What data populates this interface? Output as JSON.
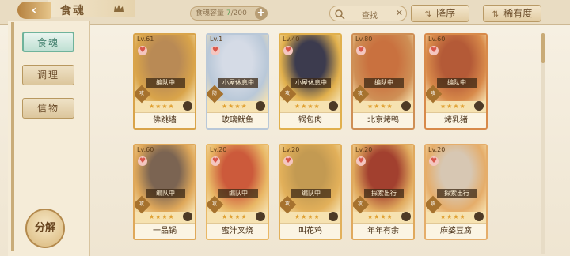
{
  "header": {
    "title": "食魂",
    "capacity_label": "食魂容量",
    "capacity_current": "7",
    "capacity_max": "/200",
    "search_label": "查找",
    "sort_desc_label": "降序",
    "sort_rarity_label": "稀有度"
  },
  "sidebar": {
    "tabs": [
      {
        "label": "食魂",
        "active": true
      },
      {
        "label": "调理",
        "active": false
      },
      {
        "label": "信物",
        "active": false
      }
    ],
    "decompose_label": "分解"
  },
  "cards": [
    {
      "level": "Lv.61",
      "status": "编队中",
      "element": "攻",
      "name": "佛跳墙",
      "bg": "#d9a44a",
      "art": "#b98a55"
    },
    {
      "level": "Lv.1",
      "status": "小屋休息中",
      "element": "防",
      "name": "玻璃鱿鱼",
      "bg": "#b9c8d8",
      "art": "#d5dbe6"
    },
    {
      "level": "Lv.40",
      "status": "小屋休息中",
      "element": "攻",
      "name": "锅包肉",
      "bg": "#e1b04d",
      "art": "#3c3b4e"
    },
    {
      "level": "Lv.80",
      "status": "编队中",
      "element": "攻",
      "name": "北京烤鸭",
      "bg": "#cf8f55",
      "art": "#c9713f"
    },
    {
      "level": "Lv.60",
      "status": "编队中",
      "element": "攻",
      "name": "烤乳猪",
      "bg": "#d88a4a",
      "art": "#b45a37"
    },
    {
      "level": "Lv.60",
      "status": "编队中",
      "element": "攻",
      "name": "一品锅",
      "bg": "#dfa85a",
      "art": "#7b6452"
    },
    {
      "level": "Lv.20",
      "status": "编队中",
      "element": "攻",
      "name": "蜜汁叉烧",
      "bg": "#e9b866",
      "art": "#cc5a3b"
    },
    {
      "level": "Lv.20",
      "status": "编队中",
      "element": "攻",
      "name": "叫花鸡",
      "bg": "#e2b05a",
      "art": "#c39a52"
    },
    {
      "level": "Lv.20",
      "status": "探索出行",
      "element": "攻",
      "name": "年年有余",
      "bg": "#e0a95d",
      "art": "#a2402f"
    },
    {
      "level": "Lv.20",
      "status": "探索出行",
      "element": "攻",
      "name": "麻婆豆腐",
      "bg": "#e5ad6a",
      "art": "#d7c7b3"
    }
  ],
  "stars": "★★★★",
  "colors": {
    "accent_green": "#6fb39b",
    "frame_gold": "#d9a44a",
    "background": "#f3ecdd"
  }
}
